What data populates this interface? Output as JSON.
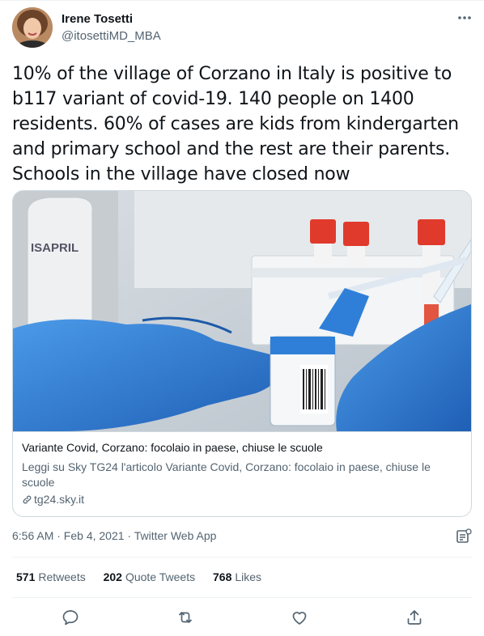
{
  "author": {
    "display_name": "Irene Tosetti",
    "handle": "@itosettiMD_MBA"
  },
  "tweet": {
    "text": "10% of the village of Corzano in Italy is positive to b117 variant of covid-19. 140 people on 1400 residents. 60% of cases are kids from kindergarten and primary school and the rest are their parents. Schools in the village have closed now",
    "timestamp": "6:56 AM · Feb 4, 2021 · Twitter Web App"
  },
  "card": {
    "image_label": "ISAPRIL",
    "title": "Variante Covid, Corzano: focolaio in paese, chiuse le scuole",
    "description": "Leggi su Sky TG24 l'articolo Variante Covid, Corzano: focolaio in paese, chiuse le scuole",
    "domain": "tg24.sky.it"
  },
  "stats": {
    "retweets_count": "571",
    "retweets_label": "Retweets",
    "quotes_count": "202",
    "quotes_label": "Quote Tweets",
    "likes_count": "768",
    "likes_label": "Likes"
  },
  "colors": {
    "text": "#0f1419",
    "secondary": "#536471",
    "border": "#cfd9de",
    "glove_blue": "#2f7fd8",
    "cap_red": "#e03a2c"
  },
  "icons": [
    "more-icon",
    "link-icon",
    "analytics-icon",
    "reply-icon",
    "retweet-icon",
    "like-icon",
    "share-icon"
  ]
}
